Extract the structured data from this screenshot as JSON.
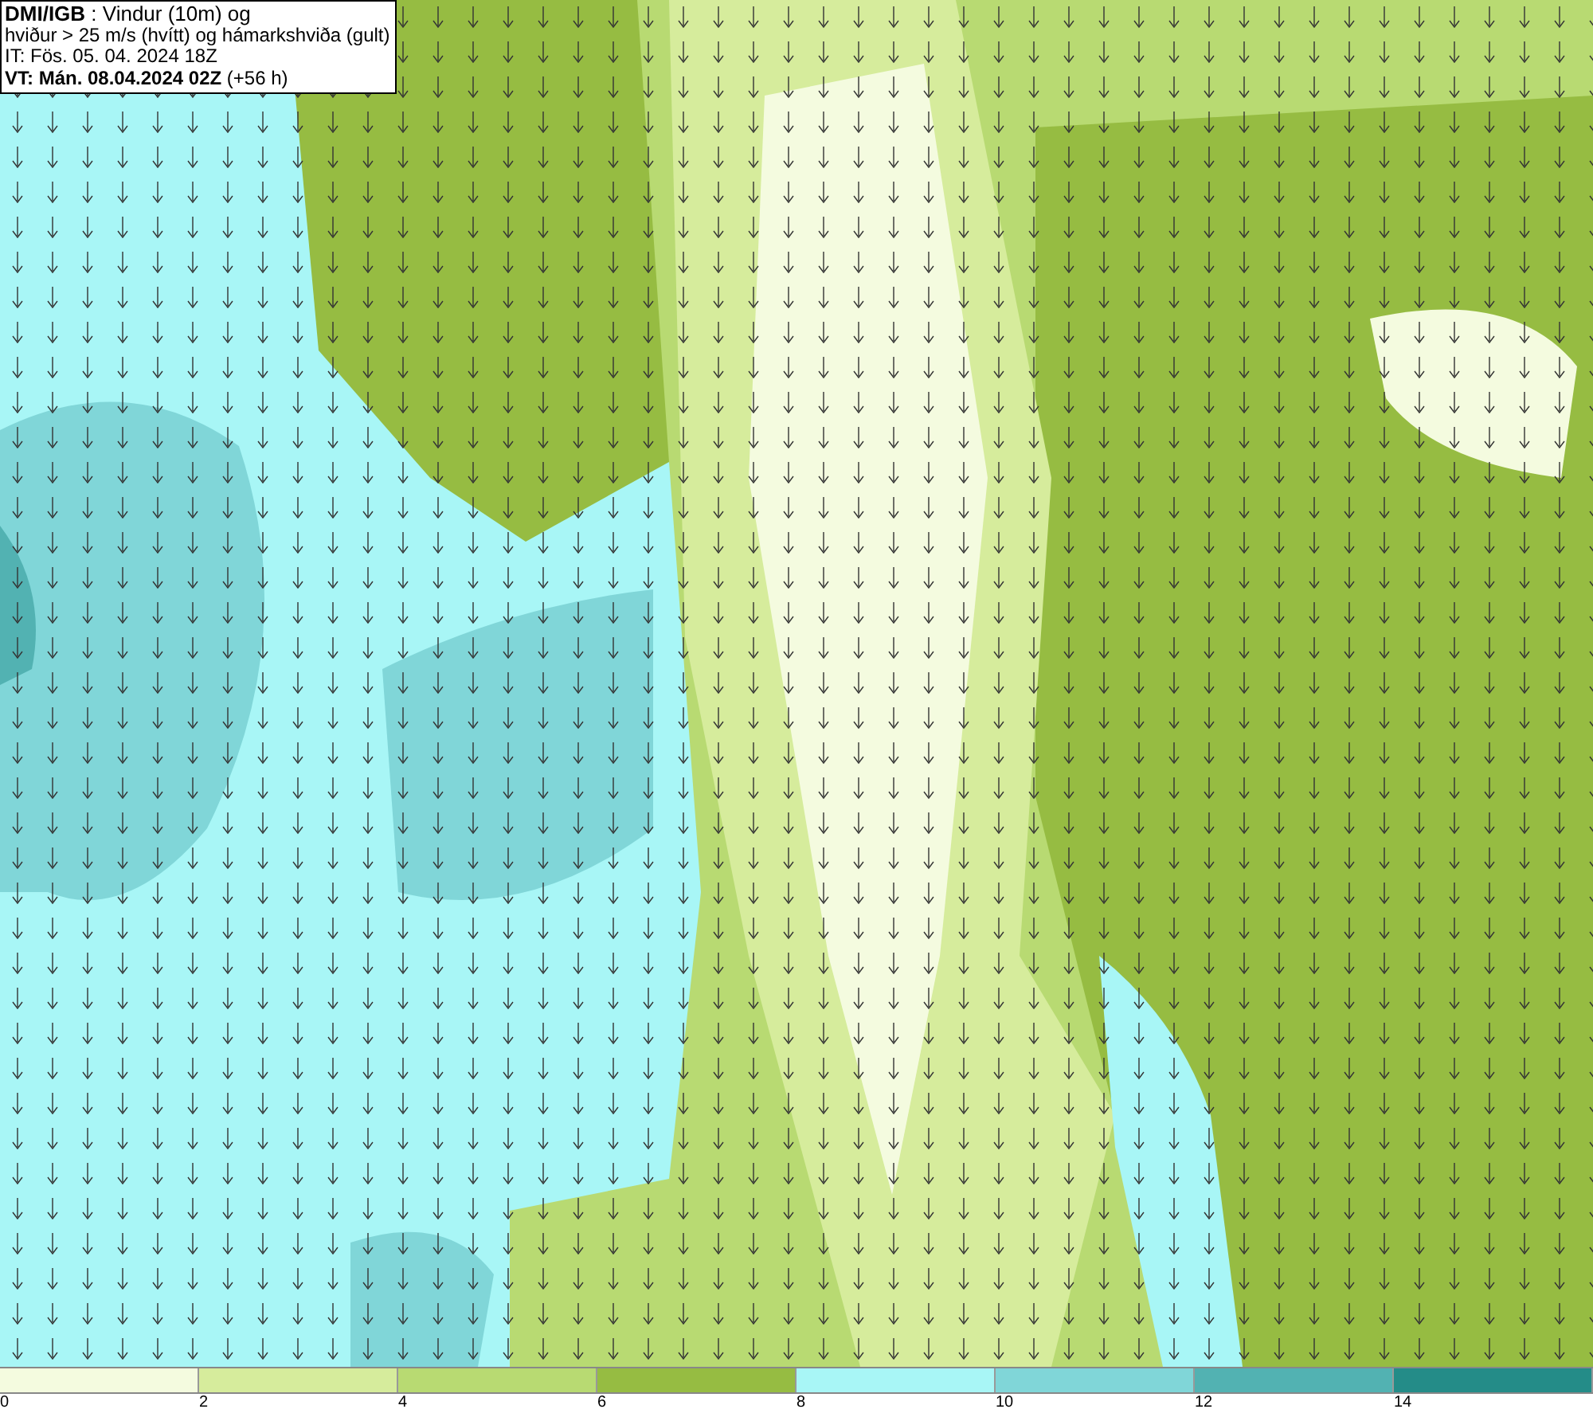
{
  "info_box": {
    "lines": [
      "**DMI/IGB** : Vindur (10m) og",
      "hviður > 25 m/s (hvítt) og hámarkshviða (gult)",
      "IT: Fös. 05. 04. 2024 18Z",
      "**VT: Mán. 08.04.2024 02Z** (+56 h)"
    ]
  },
  "legend": {
    "bins": [
      {
        "label": "0",
        "color": "#f4fbdf"
      },
      {
        "label": "2",
        "color": "#d6ec9c"
      },
      {
        "label": "4",
        "color": "#b8da72"
      },
      {
        "label": "6",
        "color": "#96bc42"
      },
      {
        "label": "8",
        "color": "#a8f6f6"
      },
      {
        "label": "10",
        "color": "#80d6d8"
      },
      {
        "label": "12",
        "color": "#52b2b2"
      },
      {
        "label": "14",
        "color": "#248c88"
      }
    ]
  }
}
